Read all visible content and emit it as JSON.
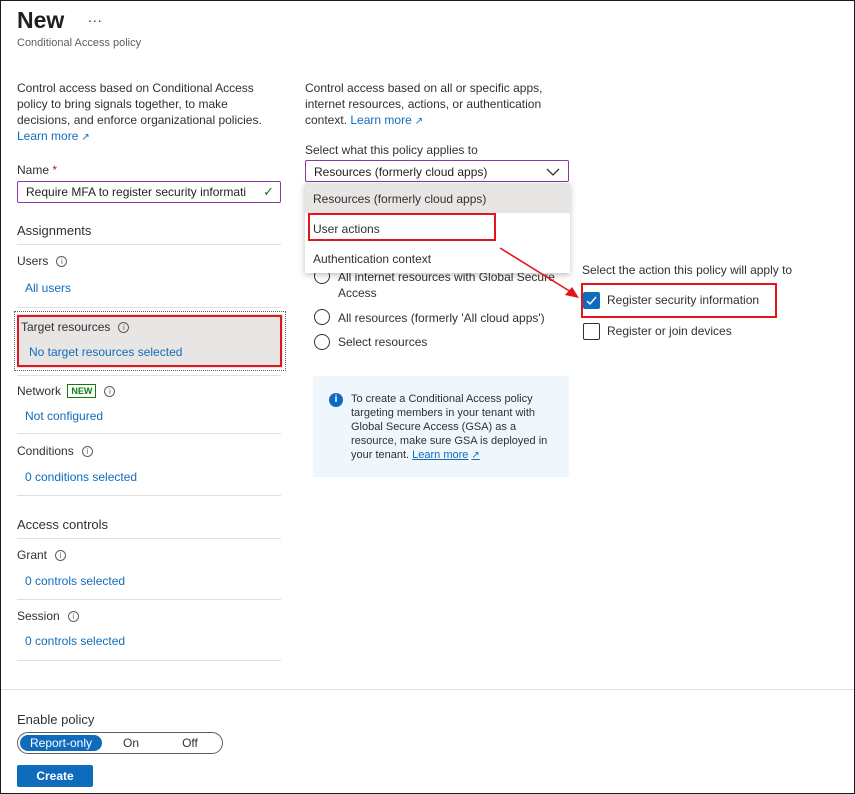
{
  "header": {
    "title": "New",
    "more_label": "...",
    "subtitle": "Conditional Access policy"
  },
  "left": {
    "description": "Control access based on Conditional Access policy to bring signals together, to make decisions, and enforce organizational policies.",
    "learn_more": "Learn more",
    "name_label": "Name",
    "required_mark": "*",
    "name_value": "Require MFA to register security informati",
    "assignments_heading": "Assignments",
    "users_label": "Users",
    "users_value": "All users",
    "target_label": "Target resources",
    "target_value": "No target resources selected",
    "network_label": "Network",
    "network_badge": "NEW",
    "network_value": "Not configured",
    "conditions_label": "Conditions",
    "conditions_value": "0 conditions selected",
    "access_heading": "Access controls",
    "grant_label": "Grant",
    "grant_value": "0 controls selected",
    "session_label": "Session",
    "session_value": "0 controls selected"
  },
  "middle": {
    "description": "Control access based on all or specific apps, internet resources, actions, or authentication context.",
    "learn_more": "Learn more",
    "select_label": "Select what this policy applies to",
    "select_value": "Resources (formerly cloud apps)",
    "dropdown_options": [
      "Resources (formerly cloud apps)",
      "User actions",
      "Authentication context"
    ],
    "radio_partial_line1": "All internet resources with Global Secure",
    "radio_partial_line2": "Access",
    "radio_all_resources": "All resources (formerly 'All cloud apps')",
    "radio_select_resources": "Select resources",
    "info_text": "To create a Conditional Access policy targeting members in your tenant with Global Secure Access (GSA) as a resource, make sure GSA is deployed in your tenant.",
    "info_learn_more": "Learn more"
  },
  "right": {
    "action_label": "Select the action this policy will apply to",
    "actions": [
      {
        "label": "Register security information",
        "checked": true
      },
      {
        "label": "Register or join devices",
        "checked": false
      }
    ]
  },
  "footer": {
    "enable_label": "Enable policy",
    "toggle_options": [
      "Report-only",
      "On",
      "Off"
    ],
    "toggle_selected": "Report-only",
    "create_label": "Create"
  },
  "colors": {
    "accent": "#0f6cbd",
    "highlight": "#e3151c",
    "new_badge": "#107c10"
  }
}
